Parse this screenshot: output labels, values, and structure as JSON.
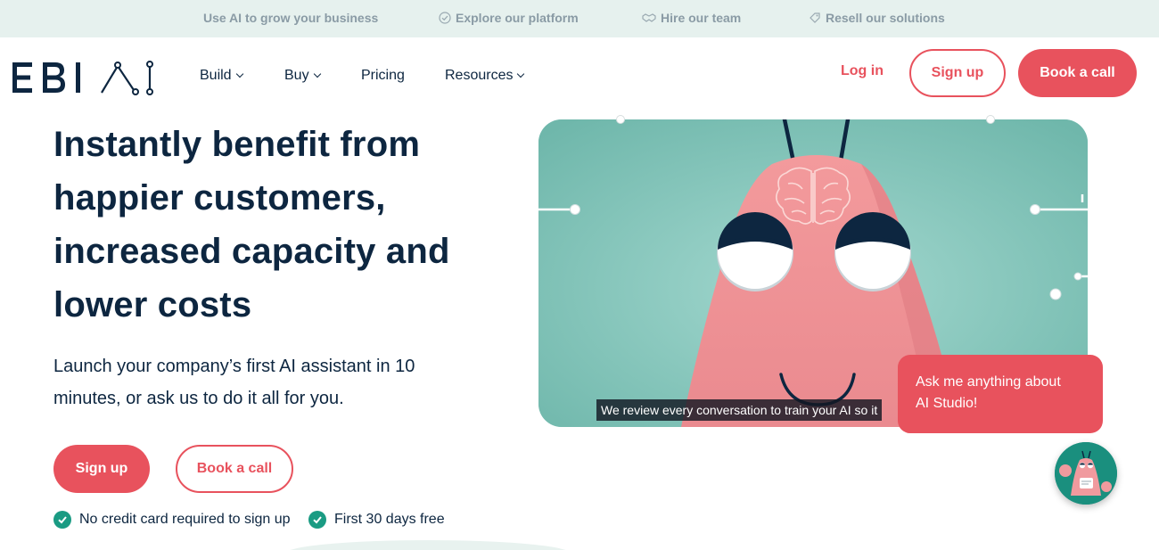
{
  "topbar": {
    "items": [
      {
        "label": "Use AI to grow your business",
        "icon": "none"
      },
      {
        "label": "Explore our platform",
        "icon": "badge-check-icon"
      },
      {
        "label": "Hire our team",
        "icon": "handshake-icon"
      },
      {
        "label": "Resell our solutions",
        "icon": "tag-icon"
      }
    ]
  },
  "nav": {
    "logo": "EBI AI",
    "items": [
      {
        "label": "Build",
        "has_dropdown": true
      },
      {
        "label": "Buy",
        "has_dropdown": true
      },
      {
        "label": "Pricing",
        "has_dropdown": false
      },
      {
        "label": "Resources",
        "has_dropdown": true
      }
    ],
    "login": "Log in",
    "signup": "Sign up",
    "book_call": "Book a call"
  },
  "hero": {
    "headline_lines": [
      "Instantly benefit from",
      "happier customers,",
      "increased capacity and",
      "lower costs"
    ],
    "subline_lines": [
      "Launch your company’s first AI assistant in 10",
      "minutes, or ask us to do it all for you."
    ],
    "signup_button": "Sign up",
    "book_call_button": "Book a call",
    "checks": [
      "No credit card required to sign up",
      "First 30 days free"
    ]
  },
  "video": {
    "caption": "We review every conversation to train your AI so it"
  },
  "chat": {
    "bubble_lines": [
      "Ask me anything about",
      "AI Studio!"
    ]
  },
  "colors": {
    "brand_red": "#e8525d",
    "navy": "#0d2640",
    "teal": "#1a9b83",
    "topbar_bg": "#e6f1ee"
  }
}
